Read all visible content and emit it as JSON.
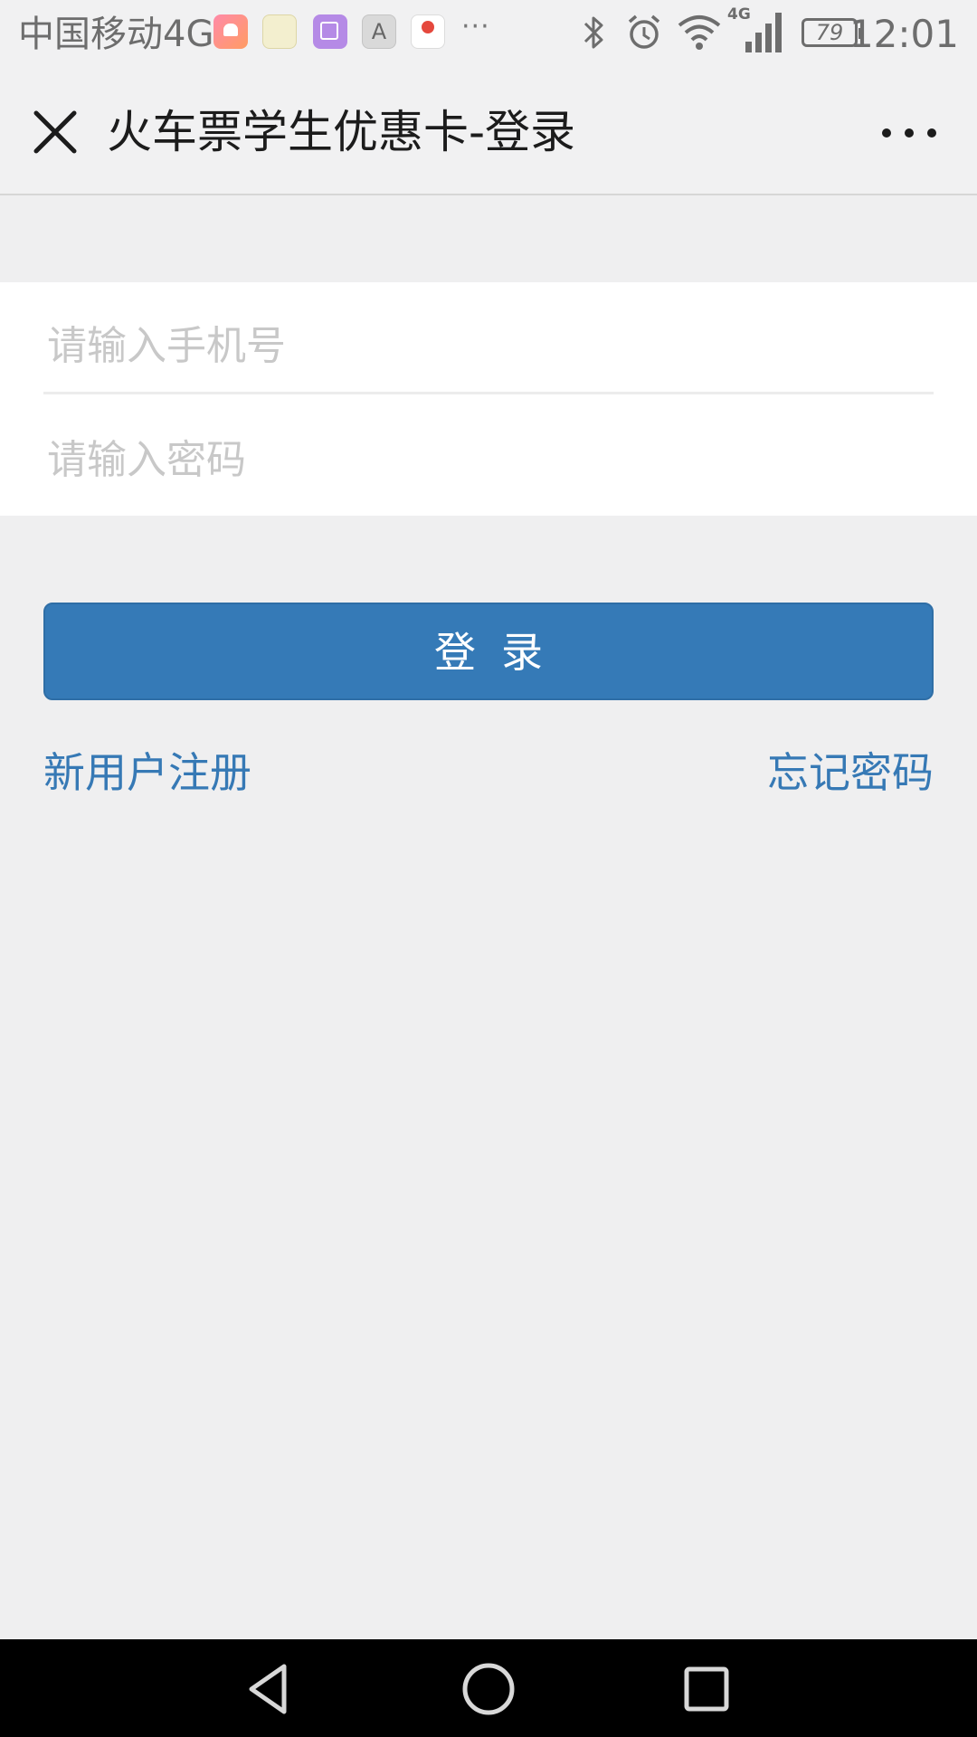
{
  "status_bar": {
    "carrier": "中国移动4G",
    "network_badge": "4G",
    "battery_level": "79",
    "time": "12:01",
    "notification_icons": [
      "health-icon",
      "education-app-icon",
      "gallery-icon",
      "font-app-icon",
      "map-icon"
    ],
    "system_icons": [
      "bluetooth-icon",
      "alarm-icon",
      "wifi-icon",
      "signal-icon",
      "battery-icon"
    ]
  },
  "header": {
    "title": "火车票学生优惠卡-登录",
    "close_icon": "close-icon",
    "more_icon": "more-icon"
  },
  "form": {
    "phone_placeholder": "请输入手机号",
    "phone_value": "",
    "password_placeholder": "请输入密码",
    "password_value": "",
    "login_label": "登录"
  },
  "links": {
    "register": "新用户注册",
    "forgot_password": "忘记密码"
  },
  "nav_bar": {
    "icons": [
      "back-triangle-icon",
      "home-circle-icon",
      "recent-square-icon"
    ]
  },
  "colors": {
    "accent": "#357ab7",
    "link": "#3679b5",
    "background": "#efeff0",
    "header_background": "#f1f1f2",
    "placeholder": "#c8c8c8",
    "nav_background": "#000000"
  }
}
